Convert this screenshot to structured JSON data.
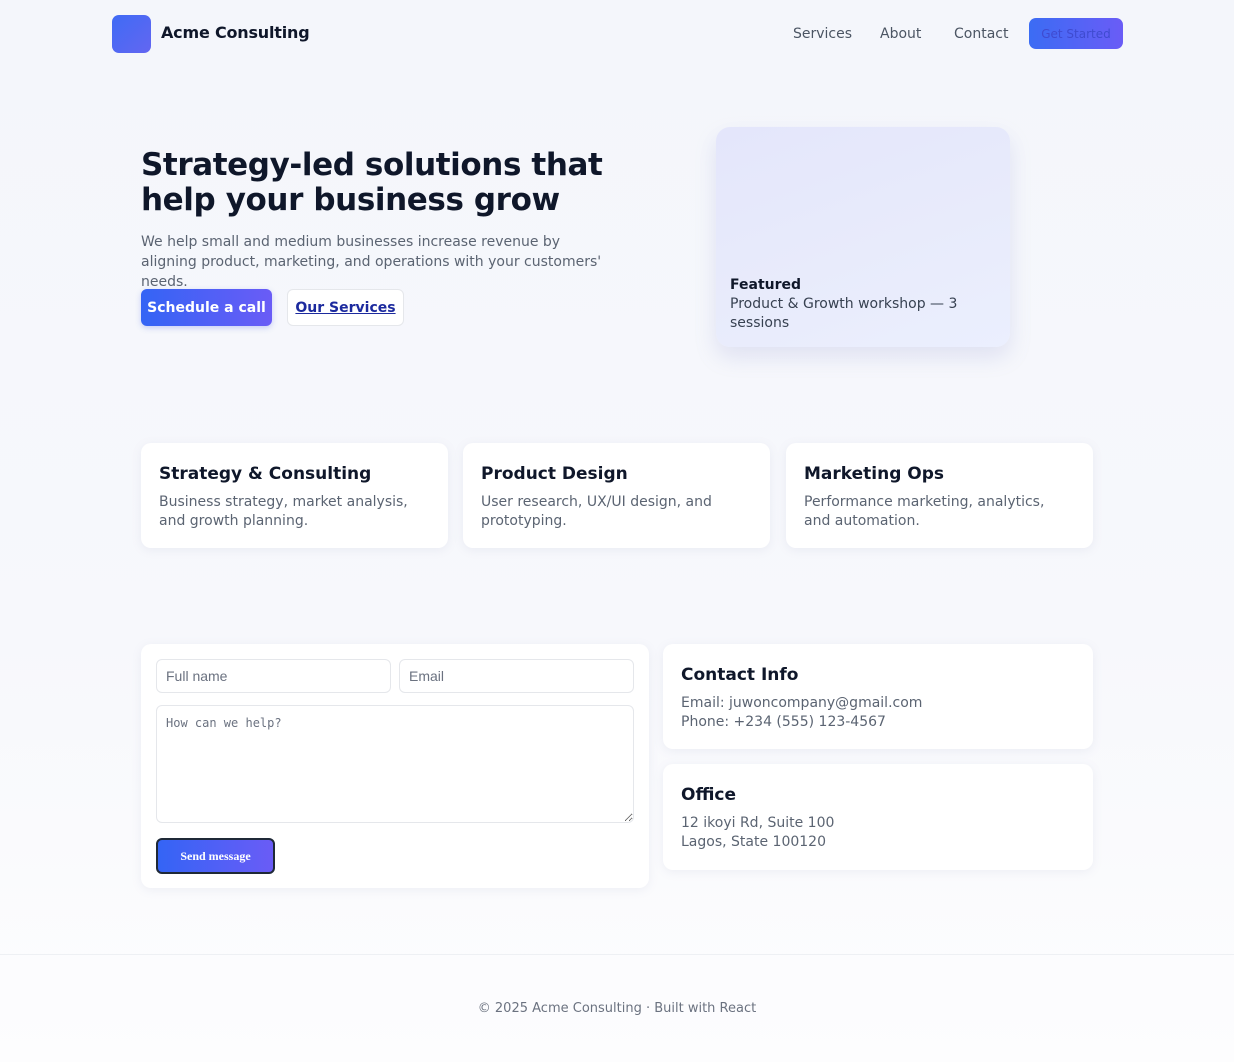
{
  "header": {
    "brand": "Acme Consulting",
    "nav": [
      "Services",
      "About",
      "Contact"
    ],
    "cta": "Get Started"
  },
  "hero": {
    "title": "Strategy-led solutions that help your business grow",
    "subtitle": "We help small and medium businesses increase revenue by aligning product, marketing, and operations with your customers' needs.",
    "primary_button": "Schedule a call",
    "secondary_button": "Our Services",
    "featured": {
      "label": "Featured",
      "text": "Product & Growth workshop — 3 sessions"
    }
  },
  "services": [
    {
      "title": "Strategy & Consulting",
      "description": "Business strategy, market analysis, and growth planning."
    },
    {
      "title": "Product Design",
      "description": "User research, UX/UI design, and prototyping."
    },
    {
      "title": "Marketing Ops",
      "description": "Performance marketing, analytics, and automation."
    }
  ],
  "contact_form": {
    "name_placeholder": "Full name",
    "email_placeholder": "Email",
    "message_placeholder": "How can we help?",
    "submit": "Send message"
  },
  "contact_info": {
    "title": "Contact Info",
    "email": "Email: juwoncompany@gmail.com",
    "phone": "Phone: +234 (555) 123-4567"
  },
  "office": {
    "title": "Office",
    "line1": "12 ikoyi Rd, Suite 100",
    "line2": "Lagos, State 100120"
  },
  "footer": {
    "text": "© 2025 Acme Consulting · Built with React"
  },
  "colors": {
    "accent_start": "#3464f5",
    "accent_end": "#6a5cf6",
    "heading": "#0f172a",
    "muted": "#5b6472"
  }
}
